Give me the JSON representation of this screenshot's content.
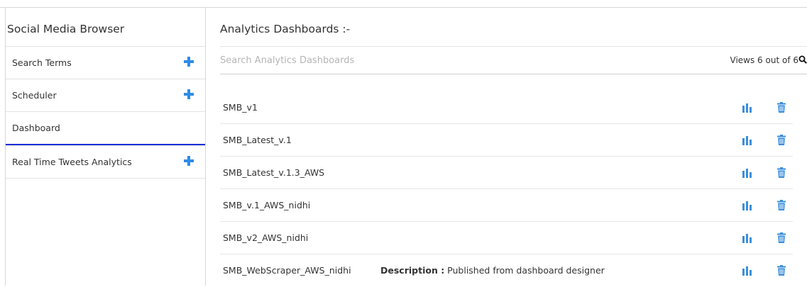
{
  "sidebar": {
    "title": "Social Media Browser",
    "items": [
      {
        "label": "Search Terms",
        "has_add": true
      },
      {
        "label": "Scheduler",
        "has_add": true
      },
      {
        "label": "Dashboard",
        "has_add": false,
        "active": true
      },
      {
        "label": "Real Time Tweets Analytics",
        "has_add": true
      }
    ]
  },
  "main": {
    "title": "Analytics Dashboards :-",
    "search": {
      "placeholder": "Search Analytics Dashboards",
      "value": ""
    },
    "views_text": "Views 6 out of 6",
    "dashboards": [
      {
        "name": "SMB_v1"
      },
      {
        "name": "SMB_Latest_v.1"
      },
      {
        "name": "SMB_Latest_v.1.3_AWS"
      },
      {
        "name": "SMB_v.1_AWS_nidhi"
      },
      {
        "name": "SMB_v2_AWS_nidhi"
      },
      {
        "name": "SMB_WebScraper_AWS_nidhi",
        "description_label": "Description :",
        "description": " Published from dashboard designer"
      }
    ]
  },
  "colors": {
    "accent_blue": "#2f8be6",
    "active_underline": "#1a2fd6",
    "icon_blue": "#3a8fdc"
  },
  "icons": {
    "add": "plus-icon",
    "view": "bar-chart-icon",
    "delete": "trash-icon",
    "search": "search-icon"
  }
}
